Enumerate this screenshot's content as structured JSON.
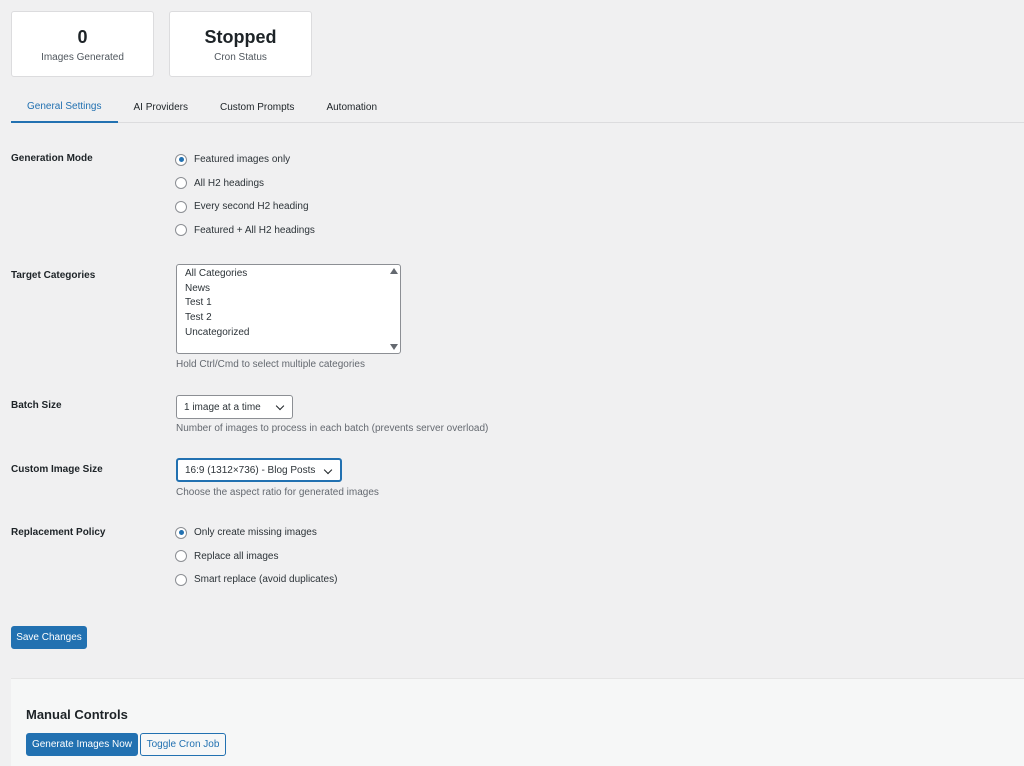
{
  "stats": [
    {
      "value": "0",
      "label": "Images Generated"
    },
    {
      "value": "Stopped",
      "label": "Cron Status"
    }
  ],
  "tabs": [
    {
      "label": "General Settings",
      "active": true
    },
    {
      "label": "AI Providers",
      "active": false
    },
    {
      "label": "Custom Prompts",
      "active": false
    },
    {
      "label": "Automation",
      "active": false
    }
  ],
  "generation_mode": {
    "label": "Generation Mode",
    "options": [
      {
        "label": "Featured images only",
        "checked": true
      },
      {
        "label": "All H2 headings",
        "checked": false
      },
      {
        "label": "Every second H2 heading",
        "checked": false
      },
      {
        "label": "Featured + All H2 headings",
        "checked": false
      }
    ]
  },
  "target_categories": {
    "label": "Target Categories",
    "options": [
      "All Categories",
      "News",
      "Test 1",
      "Test 2",
      "Uncategorized"
    ],
    "help": "Hold Ctrl/Cmd to select multiple categories"
  },
  "batch_size": {
    "label": "Batch Size",
    "value": "1 image at a time",
    "help": "Number of images to process in each batch (prevents server overload)"
  },
  "custom_image_size": {
    "label": "Custom Image Size",
    "value": "16:9 (1312×736) - Blog Posts",
    "help": "Choose the aspect ratio for generated images"
  },
  "replacement_policy": {
    "label": "Replacement Policy",
    "options": [
      {
        "label": "Only create missing images",
        "checked": true
      },
      {
        "label": "Replace all images",
        "checked": false
      },
      {
        "label": "Smart replace (avoid duplicates)",
        "checked": false
      }
    ]
  },
  "save_button": "Save Changes",
  "manual_controls": {
    "title": "Manual Controls",
    "generate_button": "Generate Images Now",
    "toggle_button": "Toggle Cron Job"
  },
  "colors": {
    "accent": "#2271b1",
    "background": "#f0f0f1"
  }
}
